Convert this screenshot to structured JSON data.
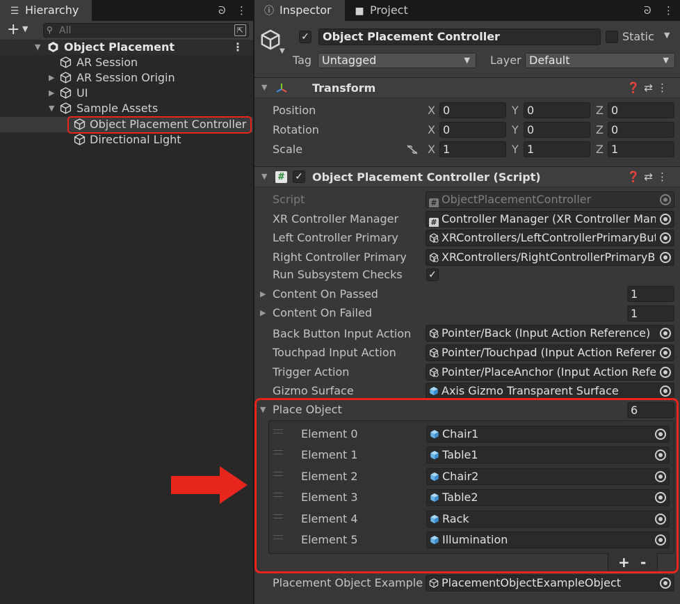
{
  "hierarchy": {
    "tab_label": "Hierarchy",
    "search_placeholder": "All",
    "root": "Object Placement",
    "items": [
      {
        "label": "AR Session"
      },
      {
        "label": "AR Session Origin"
      },
      {
        "label": "UI"
      },
      {
        "label": "Sample Assets"
      },
      {
        "label": "Object Placement Controller"
      },
      {
        "label": "Directional Light"
      }
    ]
  },
  "tabs": {
    "inspector": "Inspector",
    "project": "Project"
  },
  "inspector": {
    "object_name": "Object Placement Controller",
    "static_label": "Static",
    "tag_label": "Tag",
    "tag_value": "Untagged",
    "layer_label": "Layer",
    "layer_value": "Default",
    "transform": {
      "title": "Transform",
      "position_label": "Position",
      "rotation_label": "Rotation",
      "scale_label": "Scale",
      "axis_x": "X",
      "axis_y": "Y",
      "axis_z": "Z",
      "position": [
        "0",
        "0",
        "0"
      ],
      "rotation": [
        "0",
        "0",
        "0"
      ],
      "scale": [
        "1",
        "1",
        "1"
      ]
    },
    "script": {
      "title": "Object Placement Controller (Script)",
      "script_label": "Script",
      "script_value": "ObjectPlacementController",
      "xr_manager_label": "XR Controller Manager",
      "xr_manager_value": "Controller Manager (XR Controller Mana",
      "left_primary_label": "Left Controller Primary",
      "left_primary_value": "XRControllers/LeftControllerPrimaryBut",
      "right_primary_label": "Right Controller Primary",
      "right_primary_value": "XRControllers/RightControllerPrimaryBu",
      "run_checks_label": "Run Subsystem Checks",
      "content_passed_label": "Content On Passed",
      "content_passed_value": "1",
      "content_failed_label": "Content On Failed",
      "content_failed_value": "1",
      "back_button_label": "Back Button Input Action",
      "back_button_value": "Pointer/Back (Input Action Reference)",
      "touchpad_label": "Touchpad Input Action",
      "touchpad_value": "Pointer/Touchpad (Input Action Referer",
      "trigger_label": "Trigger Action",
      "trigger_value": "Pointer/PlaceAnchor (Input Action Refe",
      "gizmo_label": "Gizmo Surface",
      "gizmo_value": "Axis Gizmo Transparent Surface",
      "place_object_label": "Place Object",
      "place_object_count": "6",
      "elements": [
        {
          "label": "Element 0",
          "value": "Chair1"
        },
        {
          "label": "Element 1",
          "value": "Table1"
        },
        {
          "label": "Element 2",
          "value": "Chair2"
        },
        {
          "label": "Element 3",
          "value": "Table2"
        },
        {
          "label": "Element 4",
          "value": "Rack"
        },
        {
          "label": "Element 5",
          "value": "Illumination"
        }
      ],
      "add_label": "+",
      "remove_label": "-",
      "placement_example_label": "Placement Object Example",
      "placement_example_value": "PlacementObjectExampleObject"
    }
  },
  "colors": {
    "highlight": "#e8261e",
    "prefab_blue": "#6ab4e8"
  }
}
